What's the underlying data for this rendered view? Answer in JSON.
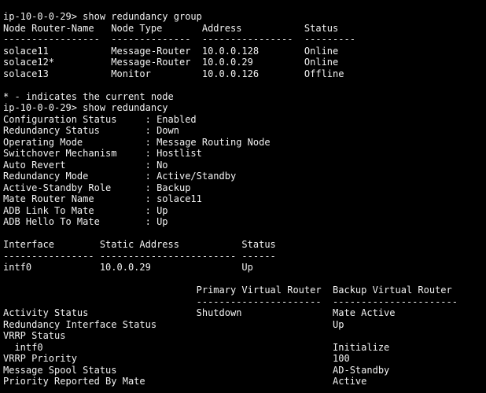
{
  "terminal": {
    "background": "#000000",
    "foreground": "#f2f2f2",
    "lines": [
      "ip-10-0-0-29> show redundancy group",
      "Node Router-Name   Node Type       Address           Status",
      "-----------------  --------------  ----------------  ---------",
      "solace11           Message-Router  10.0.0.128        Online",
      "solace12*          Message-Router  10.0.0.29         Online",
      "solace13           Monitor         10.0.0.126        Offline",
      "",
      "* - indicates the current node",
      "ip-10-0-0-29> show redundancy",
      "Configuration Status     : Enabled",
      "Redundancy Status        : Down",
      "Operating Mode           : Message Routing Node",
      "Switchover Mechanism     : Hostlist",
      "Auto Revert              : No",
      "Redundancy Mode          : Active/Standby",
      "Active-Standby Role      : Backup",
      "Mate Router Name         : solace11",
      "ADB Link To Mate         : Up",
      "ADB Hello To Mate        : Up",
      "",
      "Interface        Static Address           Status",
      "---------------- ------------------------ ------",
      "intf0            10.0.0.29                Up",
      "",
      "                                  Primary Virtual Router  Backup Virtual Router",
      "                                  ----------------------  ----------------------",
      "Activity Status                   Shutdown                Mate Active",
      "Redundancy Interface Status                               Up",
      "VRRP Status",
      "  intf0                                                   Initialize",
      "VRRP Priority                                             100",
      "Message Spool Status                                      AD-Standby",
      "Priority Reported By Mate                                 Active"
    ]
  }
}
